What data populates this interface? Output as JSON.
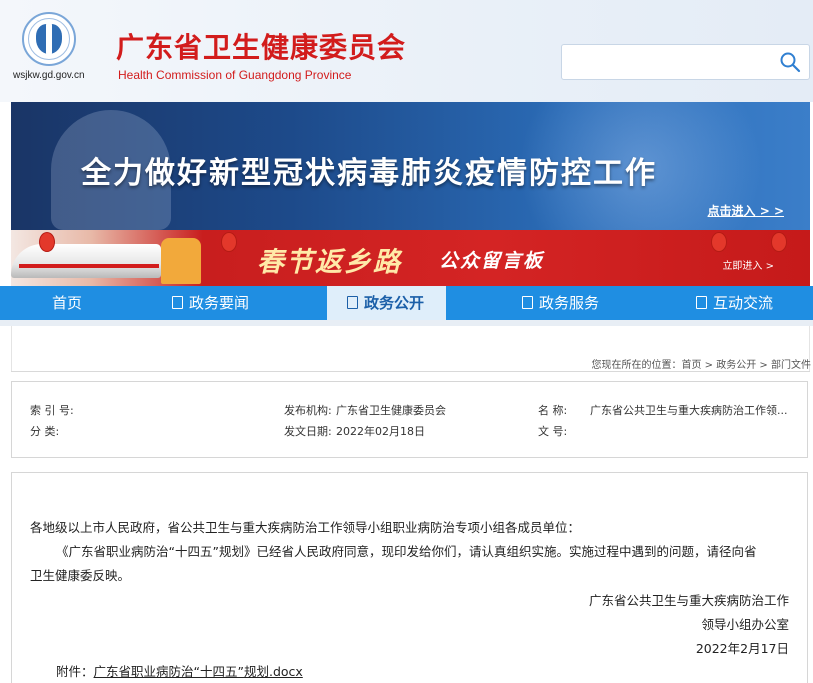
{
  "header": {
    "domain": "wsjkw.gd.gov.cn",
    "title": "广东省卫生健康委员会",
    "subtitle": "Health Commission of Guangdong Province",
    "search_value": ""
  },
  "banners": {
    "covid": {
      "title": "全力做好新型冠状病毒肺炎疫情防控工作",
      "enter": "点击进入 > >"
    },
    "spring": {
      "title": "春节返乡路",
      "subtitle": "公众留言板",
      "enter": "立即进入 >"
    }
  },
  "nav": {
    "items": [
      {
        "label": "首页"
      },
      {
        "label": "政务要闻"
      },
      {
        "label": "政务公开"
      },
      {
        "label": "政务服务"
      },
      {
        "label": "互动交流"
      }
    ],
    "active_index": 2
  },
  "breadcrumb": {
    "prefix": "您现在所在的位置：",
    "items": [
      "首页",
      "政务公开",
      "部门文件"
    ],
    "separator": " > "
  },
  "info": {
    "index_label": "索 引 号:",
    "index_value": "",
    "category_label": "分      类:",
    "category_value": "",
    "publisher_label": "发布机构:",
    "publisher_value": "广东省卫生健康委员会",
    "date_label": "发文日期:",
    "date_value": "2022年02月18日",
    "name_label": "名        称:",
    "name_value": "广东省公共卫生与重大疾病防治工作领...",
    "docno_label": "文        号:",
    "docno_value": ""
  },
  "content": {
    "salutation": "各地级以上市人民政府，省公共卫生与重大疾病防治工作领导小组职业病防治专项小组各成员单位：",
    "body_line1": "《广东省职业病防治“十四五”规划》已经省人民政府同意，现印发给你们，请认真组织实施。实施过程中遇到的问题，请径向省",
    "body_line2": "卫生健康委反映。",
    "sign_line1": "广东省公共卫生与重大疾病防治工作",
    "sign_line2": "领导小组办公室",
    "sign_date": "2022年2月17日",
    "attachment_label": "附件：",
    "attachment_link": "广东省职业病防治“十四五”规划.docx"
  },
  "colors": {
    "brand_red": "#d21c1c",
    "nav_blue": "#1f8ee2",
    "nav_active_bg": "#dfeefa"
  }
}
